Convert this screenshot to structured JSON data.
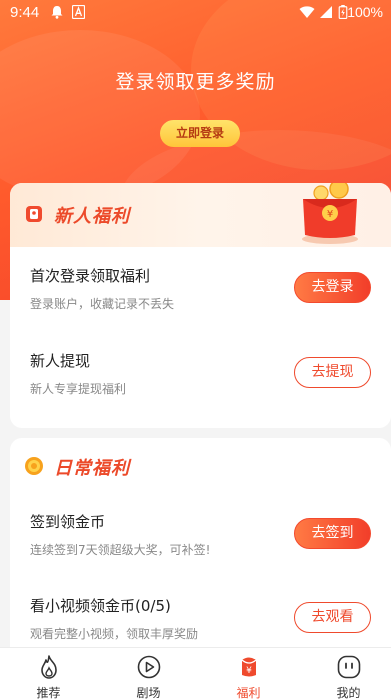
{
  "status_bar": {
    "time": "9:44",
    "battery": "100%"
  },
  "hero": {
    "title": "登录领取更多奖励",
    "login_button": "立即登录"
  },
  "newbie_card": {
    "title": "新人福利",
    "items": [
      {
        "title": "首次登录领取福利",
        "subtitle": "登录账户，收藏记录不丢失",
        "button": "去登录",
        "style": "solid"
      },
      {
        "title": "新人提现",
        "subtitle": "新人专享提现福利",
        "button": "去提现",
        "style": "outline"
      }
    ]
  },
  "daily_card": {
    "title": "日常福利",
    "items": [
      {
        "title": "签到领金币",
        "subtitle": "连续签到7天领超级大奖，可补签!",
        "button": "去签到",
        "style": "solid"
      },
      {
        "title": "看小视频领金币(0/5)",
        "subtitle": "观看完整小视频，领取丰厚奖励",
        "button": "去观看",
        "style": "outline"
      }
    ]
  },
  "tabbar": {
    "tabs": [
      {
        "label": "推荐",
        "icon": "flame-icon"
      },
      {
        "label": "剧场",
        "icon": "play-icon"
      },
      {
        "label": "福利",
        "icon": "red-envelope-icon",
        "active": true
      },
      {
        "label": "我的",
        "icon": "face-icon"
      }
    ]
  },
  "colors": {
    "accent": "#ef4a2d",
    "hero_start": "#ff7a3c",
    "hero_end": "#f23e2a",
    "login_btn": "#ffd04a"
  }
}
